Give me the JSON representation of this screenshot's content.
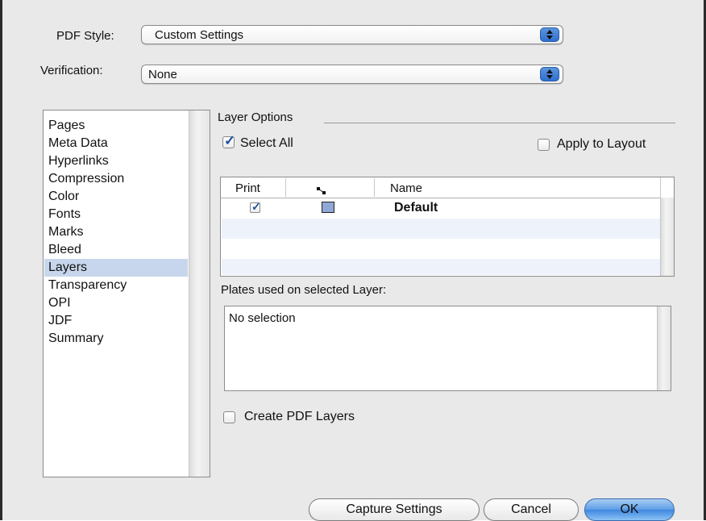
{
  "pdf_style": {
    "label": "PDF Style:",
    "value": "Custom Settings"
  },
  "verification": {
    "label": "Verification:",
    "value": "None"
  },
  "sidebar": {
    "items": [
      {
        "label": "Pages"
      },
      {
        "label": "Meta Data"
      },
      {
        "label": "Hyperlinks"
      },
      {
        "label": "Compression"
      },
      {
        "label": "Color"
      },
      {
        "label": "Fonts"
      },
      {
        "label": "Marks"
      },
      {
        "label": "Bleed"
      },
      {
        "label": "Layers",
        "selected": true
      },
      {
        "label": "Transparency"
      },
      {
        "label": "OPI"
      },
      {
        "label": "JDF"
      },
      {
        "label": "Summary"
      }
    ]
  },
  "layer_options": {
    "group_label": "Layer Options",
    "select_all": {
      "label": "Select All",
      "checked": true
    },
    "apply_to_layout": {
      "label": "Apply to Layout",
      "checked": false
    },
    "table": {
      "columns": [
        "Print",
        "",
        "Name"
      ],
      "rows": [
        {
          "print": true,
          "color": "#8fa8d6",
          "name": "Default"
        }
      ]
    },
    "plates_label": "Plates used on selected Layer:",
    "plates_text": "No selection",
    "create_pdf_layers": {
      "label": "Create PDF Layers",
      "checked": false
    }
  },
  "buttons": {
    "capture": "Capture Settings",
    "cancel": "Cancel",
    "ok": "OK"
  },
  "colors": {
    "selection": "#c7d6ec",
    "accent": "#3e86e0",
    "checkmark": "#1d4f9e"
  },
  "icons": {
    "column_icon": "layer-link-icon"
  }
}
